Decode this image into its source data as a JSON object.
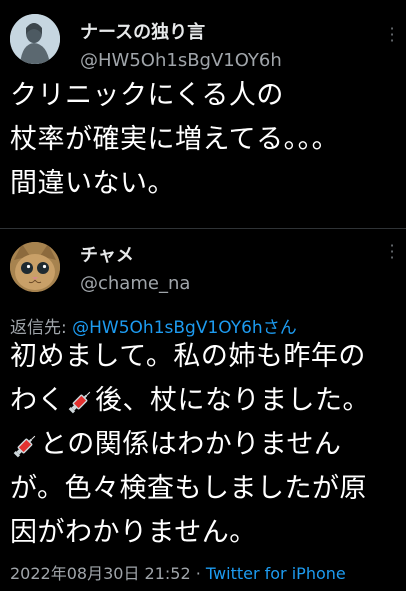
{
  "tweet1": {
    "display_name": "ナースの独り言",
    "handle": "@HW5Oh1sBgV1OY6h",
    "text_lines": [
      "クリニックにくる人の",
      "杖率が確実に増えてる。。。",
      "間違いない。"
    ],
    "avatar_icon": "nightingale-avatar-icon"
  },
  "tweet2": {
    "display_name": "チャメ",
    "handle": "@chame_na",
    "reply_label": "返信先:",
    "reply_target": "@HW5Oh1sBgV1OY6hさん",
    "line1": "初めまして。私の姉も昨年の",
    "line2_a": "わく",
    "line2_b": "後、杖になりました。",
    "line3_b": "との関係はわかりません",
    "line4": "が。色々検査もしましたが原",
    "line5": "因がわかりません。",
    "timestamp": "2022年08月30日 21:52",
    "separator": "·",
    "source": "Twitter for iPhone",
    "avatar_icon": "kitten-avatar-icon"
  },
  "icons": {
    "more": "more-options-icon",
    "syringe": "syringe-emoji-icon"
  },
  "colors": {
    "background": "#000000",
    "link": "#1d9bf0",
    "muted": "#a0a5aa",
    "syringe_red": "#e2312f"
  }
}
